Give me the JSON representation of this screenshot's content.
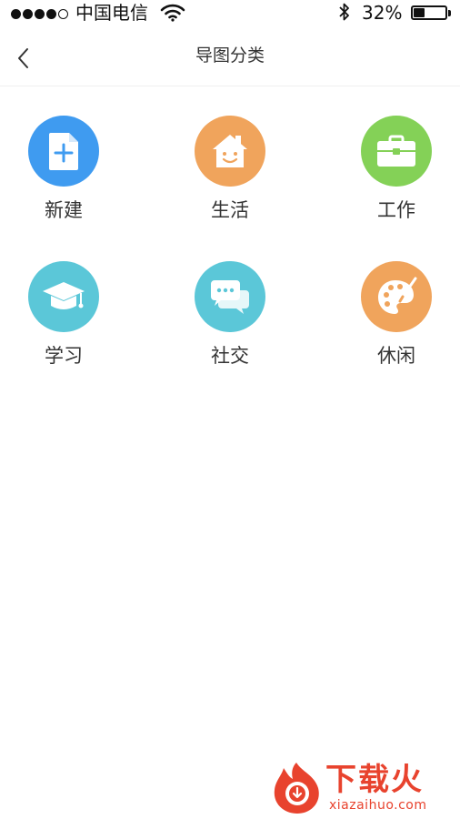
{
  "status_bar": {
    "carrier": "中国电信",
    "battery_percent": "32%",
    "battery_level": 0.32,
    "signal_filled": 4,
    "signal_total": 5
  },
  "nav": {
    "back_icon": "chevron-left-icon",
    "title": "导图分类"
  },
  "categories": [
    {
      "label": "新建",
      "icon": "new-document-icon",
      "color": "#3f9bf0"
    },
    {
      "label": "生活",
      "icon": "house-icon",
      "color": "#f0a45c"
    },
    {
      "label": "工作",
      "icon": "briefcase-icon",
      "color": "#84d157"
    },
    {
      "label": "学习",
      "icon": "graduation-cap-icon",
      "color": "#5bc7d8"
    },
    {
      "label": "社交",
      "icon": "chat-bubbles-icon",
      "color": "#5bc7d8"
    },
    {
      "label": "休闲",
      "icon": "palette-icon",
      "color": "#f0a45c"
    }
  ],
  "watermark": {
    "text": "下载火",
    "url": "xiazaihuo.com",
    "color": "#e8432e"
  }
}
